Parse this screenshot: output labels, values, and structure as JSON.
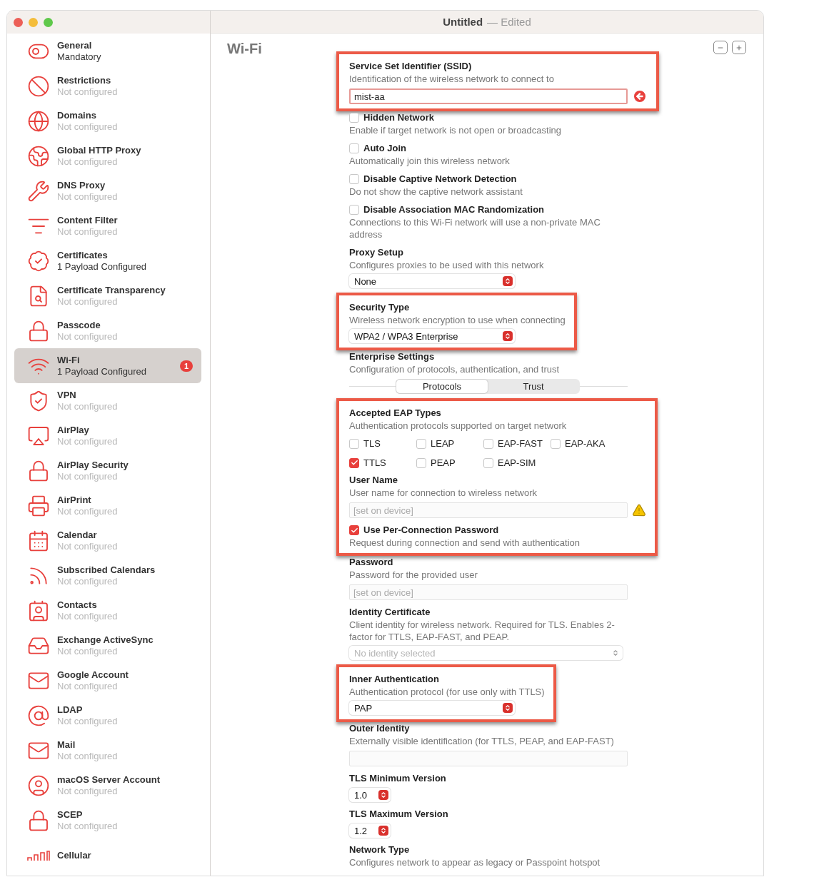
{
  "window": {
    "title": "Untitled",
    "document_state": "— Edited"
  },
  "sidebar": {
    "items": [
      {
        "name": "General",
        "status": "Mandatory",
        "configured": true,
        "selected": false
      },
      {
        "name": "Restrictions",
        "status": "Not configured",
        "configured": false,
        "selected": false
      },
      {
        "name": "Domains",
        "status": "Not configured",
        "configured": false,
        "selected": false
      },
      {
        "name": "Global HTTP Proxy",
        "status": "Not configured",
        "configured": false,
        "selected": false
      },
      {
        "name": "DNS Proxy",
        "status": "Not configured",
        "configured": false,
        "selected": false
      },
      {
        "name": "Content Filter",
        "status": "Not configured",
        "configured": false,
        "selected": false
      },
      {
        "name": "Certificates",
        "status": "1 Payload Configured",
        "configured": true,
        "selected": false
      },
      {
        "name": "Certificate Transparency",
        "status": "Not configured",
        "configured": false,
        "selected": false
      },
      {
        "name": "Passcode",
        "status": "Not configured",
        "configured": false,
        "selected": false
      },
      {
        "name": "Wi-Fi",
        "status": "1 Payload Configured",
        "configured": true,
        "selected": true,
        "badge": "1"
      },
      {
        "name": "VPN",
        "status": "Not configured",
        "configured": false,
        "selected": false
      },
      {
        "name": "AirPlay",
        "status": "Not configured",
        "configured": false,
        "selected": false
      },
      {
        "name": "AirPlay Security",
        "status": "Not configured",
        "configured": false,
        "selected": false
      },
      {
        "name": "AirPrint",
        "status": "Not configured",
        "configured": false,
        "selected": false
      },
      {
        "name": "Calendar",
        "status": "Not configured",
        "configured": false,
        "selected": false
      },
      {
        "name": "Subscribed Calendars",
        "status": "Not configured",
        "configured": false,
        "selected": false
      },
      {
        "name": "Contacts",
        "status": "Not configured",
        "configured": false,
        "selected": false
      },
      {
        "name": "Exchange ActiveSync",
        "status": "Not configured",
        "configured": false,
        "selected": false
      },
      {
        "name": "Google Account",
        "status": "Not configured",
        "configured": false,
        "selected": false
      },
      {
        "name": "LDAP",
        "status": "Not configured",
        "configured": false,
        "selected": false
      },
      {
        "name": "Mail",
        "status": "Not configured",
        "configured": false,
        "selected": false
      },
      {
        "name": "macOS Server Account",
        "status": "Not configured",
        "configured": false,
        "selected": false
      },
      {
        "name": "SCEP",
        "status": "Not configured",
        "configured": false,
        "selected": false
      },
      {
        "name": "Cellular",
        "selected": false
      }
    ]
  },
  "page": {
    "title": "Wi-Fi"
  },
  "form": {
    "groups": [
      {
        "highlighted": true,
        "sections": [
          {
            "kind": "field",
            "label": "Service Set Identifier (SSID)",
            "description": "Identification of the wireless network to connect to",
            "value": "mist-aa",
            "error": true
          }
        ]
      },
      {
        "highlighted": false,
        "sections": [
          {
            "kind": "checkbox",
            "label": "Hidden Network",
            "description": "Enable if target network is not open or broadcasting",
            "checked": false
          },
          {
            "kind": "checkbox",
            "label": "Auto Join",
            "description": "Automatically join this wireless network",
            "checked": false
          },
          {
            "kind": "checkbox",
            "label": "Disable Captive Network Detection",
            "description": "Do not show the captive network assistant",
            "checked": false
          },
          {
            "kind": "checkbox",
            "label": "Disable Association MAC Randomization",
            "description": "Connections to this Wi-Fi network will use a non-private MAC address",
            "checked": false
          },
          {
            "kind": "select",
            "label": "Proxy Setup",
            "description": "Configures proxies to be used with this network",
            "value": "None",
            "disabled": false
          }
        ]
      },
      {
        "highlighted": true,
        "sections": [
          {
            "kind": "select",
            "label": "Security Type",
            "description": "Wireless network encryption to use when connecting",
            "value": "WPA2 / WPA3 Enterprise",
            "disabled": false
          }
        ]
      },
      {
        "highlighted": false,
        "sections": [
          {
            "kind": "segmented",
            "label": "Enterprise Settings",
            "description": "Configuration of protocols, authentication, and trust",
            "tabs": [
              {
                "label": "Protocols",
                "selected": true
              },
              {
                "label": "Trust",
                "selected": false
              }
            ]
          }
        ]
      },
      {
        "highlighted": true,
        "sections": [
          {
            "kind": "checkgrid",
            "label": "Accepted EAP Types",
            "description": "Authentication protocols supported on target network",
            "options": [
              {
                "label": "TLS",
                "checked": false
              },
              {
                "label": "LEAP",
                "checked": false
              },
              {
                "label": "EAP-FAST",
                "checked": false
              },
              {
                "label": "EAP-AKA",
                "checked": false
              },
              {
                "label": "TTLS",
                "checked": true
              },
              {
                "label": "PEAP",
                "checked": false
              },
              {
                "label": "EAP-SIM",
                "checked": false
              }
            ]
          },
          {
            "kind": "field",
            "label": "User Name",
            "description": "User name for connection to wireless network",
            "placeholder": "[set on device]",
            "error": false,
            "warning": true
          },
          {
            "kind": "checkbox",
            "label": "Use Per-Connection Password",
            "description": "Request during connection and send with authentication",
            "checked": true
          }
        ]
      },
      {
        "highlighted": false,
        "sections": [
          {
            "kind": "field",
            "label": "Password",
            "description": "Password for the provided user",
            "placeholder": "[set on device]",
            "error": false
          },
          {
            "kind": "select",
            "label": "Identity Certificate",
            "description": "Client identity for wireless network. Required for TLS. Enables 2-factor for TTLS, EAP-FAST, and PEAP.",
            "placeholder": "No identity selected",
            "disabled": true
          }
        ]
      },
      {
        "highlighted": true,
        "sections": [
          {
            "kind": "select",
            "label": "Inner Authentication",
            "description": "Authentication protocol (for use only with TTLS)",
            "value": "PAP",
            "disabled": false
          }
        ]
      },
      {
        "highlighted": false,
        "sections": [
          {
            "kind": "field",
            "label": "Outer Identity",
            "description": "Externally visible identification (for TTLS, PEAP, and EAP-FAST)",
            "error": false
          },
          {
            "kind": "compact_select",
            "label": "TLS Minimum Version",
            "value": "1.0"
          },
          {
            "kind": "compact_select",
            "label": "TLS Maximum Version",
            "value": "1.2"
          },
          {
            "kind": "heading",
            "label": "Network Type",
            "description": "Configures network to appear as legacy or Passpoint hotspot"
          }
        ]
      }
    ]
  }
}
